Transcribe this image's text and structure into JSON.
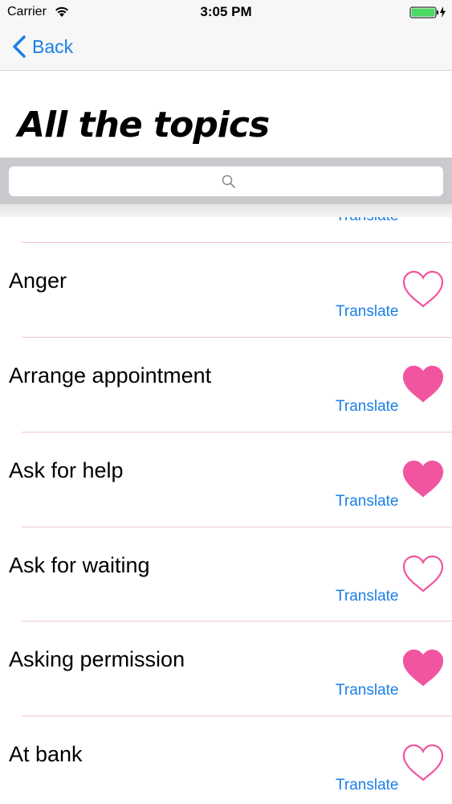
{
  "status_bar": {
    "carrier": "Carrier",
    "time": "3:05 PM"
  },
  "nav": {
    "back_label": "Back"
  },
  "page_title": "All the topics",
  "search": {
    "placeholder": ""
  },
  "partial_row": {
    "translate_label": "Translate"
  },
  "topics": [
    {
      "title": "Anger",
      "translate_label": "Translate",
      "favorited": false
    },
    {
      "title": "Arrange appointment",
      "translate_label": "Translate",
      "favorited": true
    },
    {
      "title": "Ask for help",
      "translate_label": "Translate",
      "favorited": true
    },
    {
      "title": "Ask for waiting",
      "translate_label": "Translate",
      "favorited": false
    },
    {
      "title": "Asking permission",
      "translate_label": "Translate",
      "favorited": true
    },
    {
      "title": "At bank",
      "translate_label": "Translate",
      "favorited": false
    }
  ],
  "colors": {
    "accent": "#1b7fe6",
    "heart": "#f2559f",
    "separator": "#f1c5cc",
    "battery": "#4cd964"
  },
  "icons": {
    "wifi": "wifi-icon",
    "battery": "battery-icon",
    "back": "chevron-left-icon",
    "search": "search-icon",
    "favorite": "heart-icon"
  }
}
